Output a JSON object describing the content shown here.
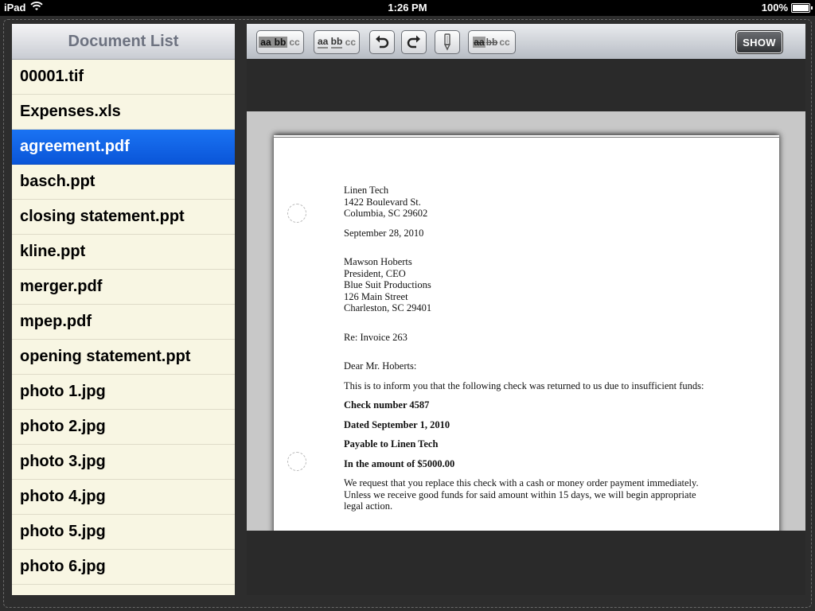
{
  "status_bar": {
    "device": "iPad",
    "time": "1:26 PM",
    "battery": "100%"
  },
  "sidebar": {
    "title": "Document List",
    "selected_index": 2,
    "items": [
      "00001.tif",
      "Expenses.xls",
      "agreement.pdf",
      "basch.ppt",
      "closing statement.ppt",
      "kline.ppt",
      "merger.pdf",
      "mpep.pdf",
      "opening statement.ppt",
      "photo 1.jpg",
      "photo 2.jpg",
      "photo 3.jpg",
      "photo 4.jpg",
      "photo 5.jpg",
      "photo 6.jpg"
    ]
  },
  "toolbar": {
    "highlight_a": "aa",
    "highlight_b": "bb",
    "highlight_c": "cc",
    "underline_a": "aa",
    "underline_b": "bb",
    "underline_c": "cc",
    "strike_a": "aa",
    "strike_b": "bb",
    "strike_c": "cc",
    "show_label": "SHOW"
  },
  "letter": {
    "sender": [
      "Linen Tech",
      "1422 Boulevard St.",
      "Columbia, SC 29602"
    ],
    "date": "September 28, 2010",
    "recipient": [
      "Mawson Hoberts",
      "President, CEO",
      "Blue Suit Productions",
      "126 Main Street",
      "Charleston, SC 29401"
    ],
    "re": "Re: Invoice 263",
    "salutation": "Dear Mr. Hoberts:",
    "intro": "This is to inform you that the following check was returned to us due to insufficient funds:",
    "check_number": "Check number 4587",
    "dated": "Dated September 1, 2010",
    "payable": "Payable to Linen Tech",
    "amount": "In the amount of $5000.00",
    "request": [
      "We request that you replace this check with a cash or money order payment immediately.",
      "Unless we receive good funds for said amount within 15 days, we will begin appropriate",
      "legal action."
    ]
  }
}
